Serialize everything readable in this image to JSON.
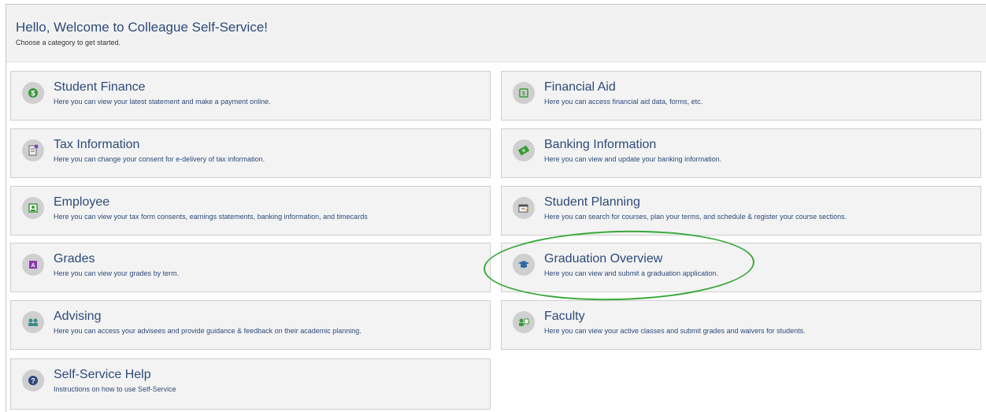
{
  "header": {
    "title": "Hello, Welcome to Colleague Self-Service!",
    "subtitle": "Choose a category to get started."
  },
  "tiles": [
    {
      "title": "Student Finance",
      "desc": "Here you can view your latest statement and make a payment online.",
      "icon": "dollar-icon",
      "color": "#3a9a3a"
    },
    {
      "title": "Financial Aid",
      "desc": "Here you can access financial aid data, forms, etc.",
      "icon": "financial-aid-icon",
      "color": "#3a9a3a"
    },
    {
      "title": "Tax Information",
      "desc": "Here you can change your consent for e-delivery of tax information.",
      "icon": "tax-document-icon",
      "color": "#7a4ab0"
    },
    {
      "title": "Banking Information",
      "desc": "Here you can view and update your banking information.",
      "icon": "money-icon",
      "color": "#3a9a3a"
    },
    {
      "title": "Employee",
      "desc": "Here you can view your tax form consents, earnings statements, banking information, and timecards",
      "icon": "employee-badge-icon",
      "color": "#3a9a3a"
    },
    {
      "title": "Student Planning",
      "desc": "Here you can search for courses, plan your terms, and schedule & register your course sections.",
      "icon": "calendar-icon",
      "color": "#5a5a7a"
    },
    {
      "title": "Grades",
      "desc": "Here you can view your grades by term.",
      "icon": "grades-icon",
      "color": "#8a3ab0"
    },
    {
      "title": "Graduation Overview",
      "desc": "Here you can view and submit a graduation application.",
      "icon": "graduation-cap-icon",
      "color": "#2e6aa8"
    },
    {
      "title": "Advising",
      "desc": "Here you can access your advisees and provide guidance & feedback on their academic planning.",
      "icon": "advising-people-icon",
      "color": "#3a8a8a"
    },
    {
      "title": "Faculty",
      "desc": "Here you can view your active classes and submit grades and waivers for students.",
      "icon": "faculty-icon",
      "color": "#3a9a3a"
    },
    {
      "title": "Self-Service Help",
      "desc": "Instructions on how to use Self-Service",
      "icon": "help-icon",
      "color": "#2e4a7a"
    }
  ]
}
